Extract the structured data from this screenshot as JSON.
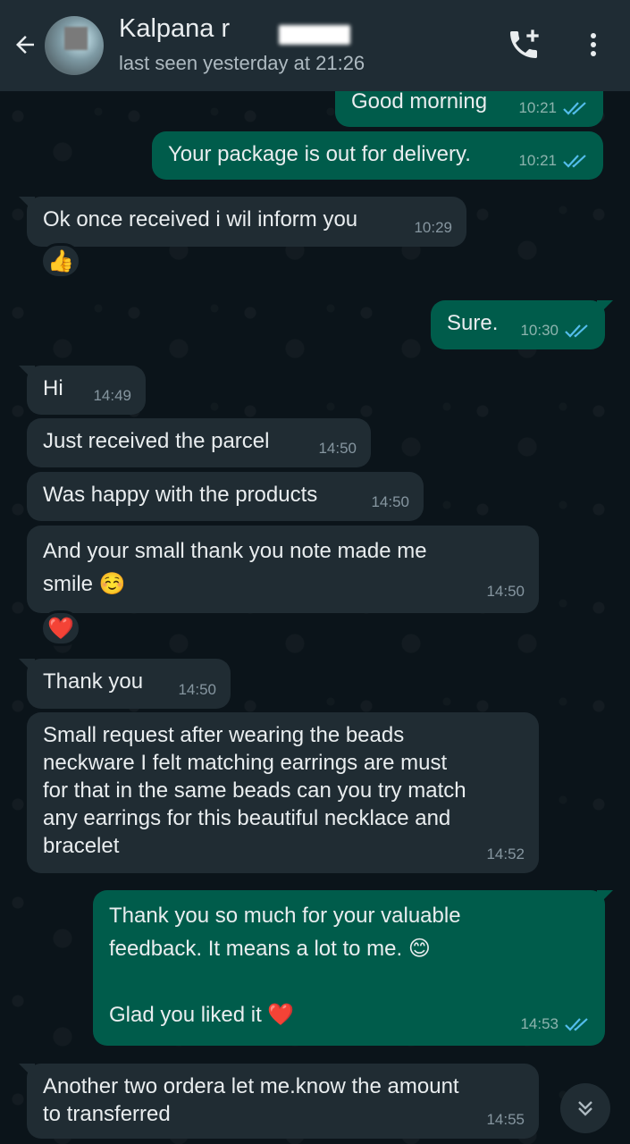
{
  "header": {
    "contact_name": "Kalpana r",
    "last_seen": "last seen yesterday at 21:26",
    "back_icon": "arrow-left-icon",
    "call_icon": "add-call-icon",
    "menu_icon": "more-vertical-icon"
  },
  "colors": {
    "header_bg": "#1f2c34",
    "chat_bg": "#0b141a",
    "outgoing_bubble": "#005c4b",
    "incoming_bubble": "#202c33",
    "read_ticks": "#53bdeb"
  },
  "messages": [
    {
      "dir": "out",
      "text": "Good morning",
      "time": "10:21",
      "status": "read"
    },
    {
      "dir": "out",
      "text": "Your package is out for delivery.",
      "time": "10:21",
      "status": "read"
    },
    {
      "dir": "in",
      "text": "Ok once received i wil inform you",
      "time": "10:29",
      "reaction": "👍"
    },
    {
      "dir": "out",
      "text": "Sure.",
      "time": "10:30",
      "status": "read"
    },
    {
      "dir": "in",
      "text": "Hi",
      "time": "14:49"
    },
    {
      "dir": "in",
      "text": "Just received the parcel",
      "time": "14:50"
    },
    {
      "dir": "in",
      "text": "Was happy with the products",
      "time": "14:50"
    },
    {
      "dir": "in",
      "text": "And your small thank you note made me\nsmile ☺️",
      "time": "14:50",
      "reaction": "❤️"
    },
    {
      "dir": "in",
      "text": "Thank you",
      "time": "14:50"
    },
    {
      "dir": "in",
      "text": "Small request after wearing the beads\nneckware I felt matching earrings are must\nfor that in the same beads can you try match\nany earrings for this beautiful necklace and\nbracelet",
      "time": "14:52"
    },
    {
      "dir": "out",
      "text": "Thank you so much for your valuable\nfeedback. It means a lot to me. 😊\n\nGlad you liked it ❤️",
      "time": "14:53",
      "status": "read"
    },
    {
      "dir": "in",
      "text": "Another two ordera let me.know the amount\nto transferred",
      "time": "14:55"
    }
  ],
  "scroll_button_icon": "double-chevron-down-icon"
}
